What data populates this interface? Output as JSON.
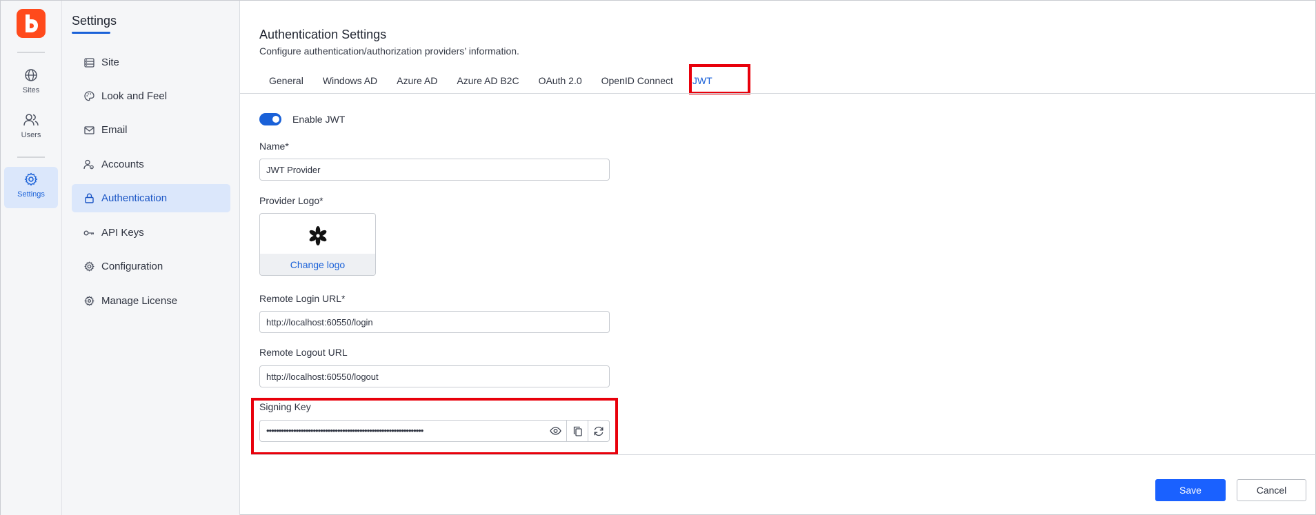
{
  "rail": {
    "items": [
      {
        "label": "Sites",
        "icon": "globe-icon"
      },
      {
        "label": "Users",
        "icon": "users-icon"
      },
      {
        "label": "Settings",
        "icon": "gear-icon"
      }
    ],
    "brand_color": "#ff4a1c"
  },
  "sidebar": {
    "title": "Settings",
    "items": [
      {
        "label": "Site",
        "icon": "site-icon"
      },
      {
        "label": "Look and Feel",
        "icon": "palette-icon"
      },
      {
        "label": "Email",
        "icon": "mail-icon"
      },
      {
        "label": "Accounts",
        "icon": "accounts-icon"
      },
      {
        "label": "Authentication",
        "icon": "lock-icon",
        "active": true
      },
      {
        "label": "API Keys",
        "icon": "key-icon"
      },
      {
        "label": "Configuration",
        "icon": "gear-icon"
      },
      {
        "label": "Manage License",
        "icon": "license-icon"
      }
    ]
  },
  "main": {
    "title": "Authentication Settings",
    "subtitle": "Configure authentication/authorization providers’ information.",
    "tabs": [
      {
        "label": "General"
      },
      {
        "label": "Windows AD"
      },
      {
        "label": "Azure AD"
      },
      {
        "label": "Azure AD B2C"
      },
      {
        "label": "OAuth 2.0"
      },
      {
        "label": "OpenID Connect"
      },
      {
        "label": "JWT",
        "active": true
      }
    ],
    "form": {
      "enable_label": "Enable JWT",
      "enabled": true,
      "name_label": "Name*",
      "name_value": "JWT Provider",
      "logo_label": "Provider Logo*",
      "change_logo": "Change logo",
      "login_url_label": "Remote Login URL*",
      "login_url_value": "http://localhost:60550/login",
      "logout_url_label": "Remote Logout URL",
      "logout_url_value": "http://localhost:60550/logout",
      "signing_key_label": "Signing Key",
      "signing_key_value": "••••••••••••••••••••••••••••••••••••••••••••••••••••••••••••••••"
    },
    "actions": {
      "save": "Save",
      "cancel": "Cancel"
    },
    "accent_color": "#1a61d8",
    "highlight_color": "#e8000b"
  }
}
